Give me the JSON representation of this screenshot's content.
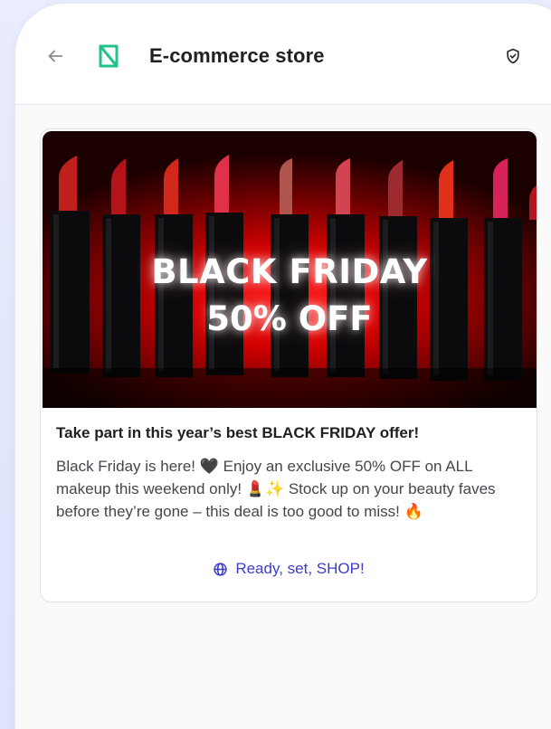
{
  "header": {
    "title": "E-commerce store",
    "back_icon": "arrow-left-icon",
    "logo_icon": "brand-logo-icon",
    "shield_icon": "shield-check-icon",
    "logo_color": "#1fc38a"
  },
  "card": {
    "banner": {
      "line1": "BLACK FRIDAY",
      "line2": "50% OFF"
    },
    "title": "Take part in this year’s best BLACK FRIDAY offer!",
    "body": "Black Friday is here! 🖤 Enjoy an exclusive 50% OFF on ALL makeup this weekend only! 💄✨ Stock up on your beauty faves before they’re gone – this deal is too good to miss! 🔥",
    "cta_label": "Ready, set, SHOP!",
    "cta_icon": "globe-icon",
    "cta_color": "#3c3cc8"
  }
}
